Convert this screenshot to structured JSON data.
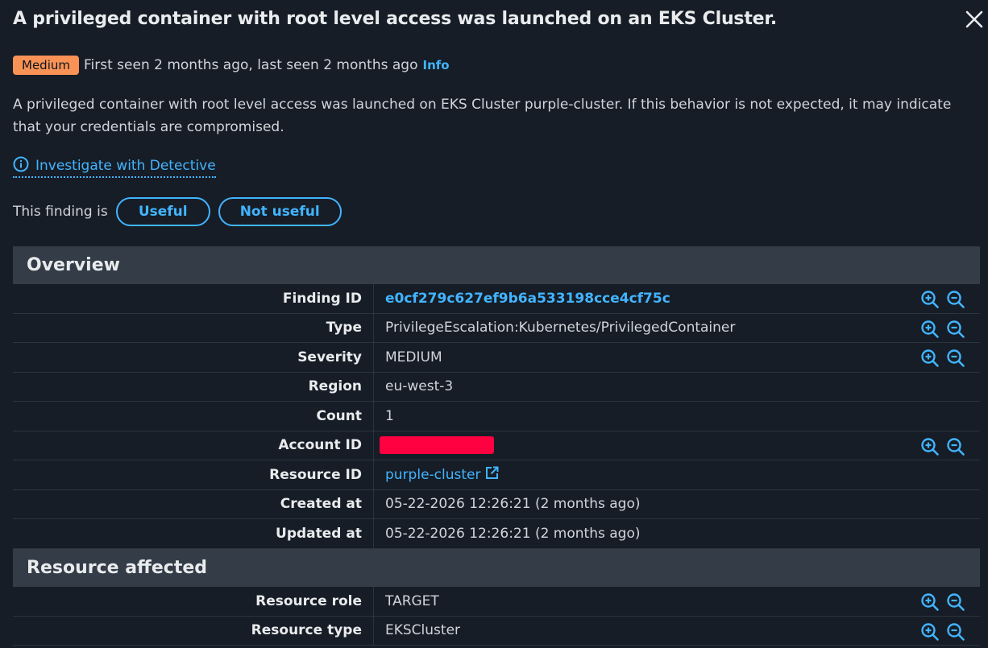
{
  "header": {
    "title": "A privileged container with root level access was launched on an EKS Cluster."
  },
  "meta": {
    "severity_badge": "Medium",
    "seen_text": "First seen 2 months ago, last seen 2 months ago",
    "info_link": "Info"
  },
  "description": "A privileged container with root level access was launched on EKS Cluster purple-cluster. If this behavior is not expected, it may indicate that your credentials are compromised.",
  "investigate_link": "Investigate with Detective",
  "feedback": {
    "prompt": "This finding is",
    "useful_label": "Useful",
    "not_useful_label": "Not useful"
  },
  "overview": {
    "title": "Overview",
    "rows": [
      {
        "label": "Finding ID",
        "value": "e0cf279c627ef9b6a533198cce4cf75c"
      },
      {
        "label": "Type",
        "value": "PrivilegeEscalation:Kubernetes/PrivilegedContainer"
      },
      {
        "label": "Severity",
        "value": "MEDIUM"
      },
      {
        "label": "Region",
        "value": "eu-west-3"
      },
      {
        "label": "Count",
        "value": "1"
      },
      {
        "label": "Account ID",
        "value": ""
      },
      {
        "label": "Resource ID",
        "value": "purple-cluster"
      },
      {
        "label": "Created at",
        "value": "05-22-2026 12:26:21 (2 months ago)"
      },
      {
        "label": "Updated at",
        "value": "05-22-2026 12:26:21 (2 months ago)"
      }
    ]
  },
  "resource_affected": {
    "title": "Resource affected",
    "rows": [
      {
        "label": "Resource role",
        "value": "TARGET"
      },
      {
        "label": "Resource type",
        "value": "EKSCluster"
      }
    ]
  },
  "colors": {
    "background": "#161d26",
    "accent": "#42b4ff",
    "badge_medium": "#f89256",
    "redaction": "#ff0040"
  }
}
